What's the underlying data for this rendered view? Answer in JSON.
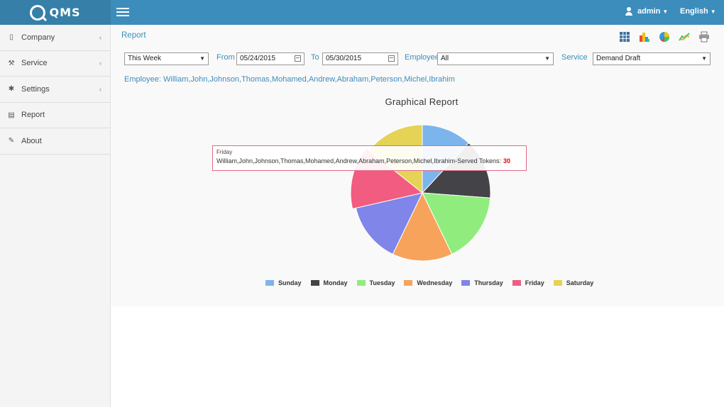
{
  "app": {
    "logo_text": "QMS"
  },
  "topbar": {
    "user": "admin",
    "language": "English"
  },
  "sidebar": {
    "items": [
      {
        "label": "Company",
        "icon": "building-icon",
        "has_submenu": true
      },
      {
        "label": "Service",
        "icon": "wrench-icon",
        "has_submenu": true
      },
      {
        "label": "Settings",
        "icon": "gear-icon",
        "has_submenu": true
      },
      {
        "label": "Report",
        "icon": "document-icon",
        "has_submenu": false
      },
      {
        "label": "About",
        "icon": "edit-icon",
        "has_submenu": false
      }
    ]
  },
  "page": {
    "title": "Report"
  },
  "toolbar": {
    "icons": [
      "grid-icon",
      "bar-chart-icon",
      "pie-chart-icon",
      "line-chart-icon",
      "print-icon"
    ]
  },
  "filters": {
    "period": "This Week",
    "from_label": "From",
    "from_value": "05/24/2015",
    "to_label": "To",
    "to_value": "05/30/2015",
    "employee_label": "Employee",
    "employee_value": "All",
    "service_label": "Service",
    "service_value": "Demand Draft"
  },
  "employee_line": "Employee: William,John,Johnson,Thomas,Mohamed,Andrew,Abraham,Peterson,Michel,Ibrahim",
  "tooltip": {
    "day": "Friday",
    "text": "William,John,Johnson,Thomas,Mohamed,Andrew,Abraham,Peterson,Michel,Ibrahim-Served Tokens:",
    "value": "30"
  },
  "chart_data": {
    "type": "pie",
    "title": "Graphical Report",
    "categories": [
      "Sunday",
      "Monday",
      "Tuesday",
      "Wednesday",
      "Thursday",
      "Friday",
      "Saturday"
    ],
    "values": [
      25,
      30,
      35,
      30,
      30,
      30,
      30
    ],
    "colors": [
      "#7cb5ec",
      "#434348",
      "#90ed7d",
      "#f7a35c",
      "#8085e9",
      "#f15c80",
      "#e4d354"
    ],
    "highlighted": "Friday",
    "legend_position": "bottom"
  }
}
